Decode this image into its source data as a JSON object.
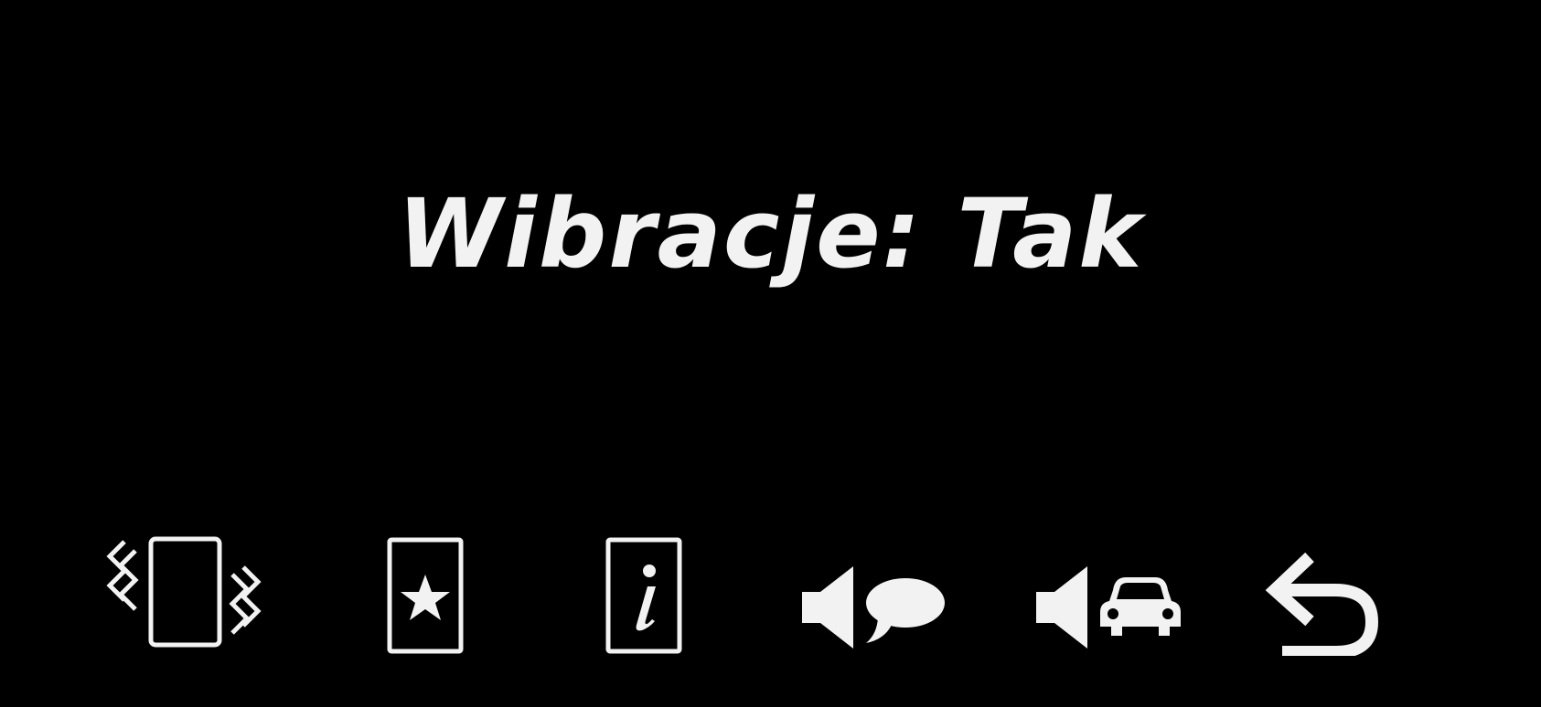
{
  "screen": {
    "status_text": "Wibracje: Tak"
  },
  "toolbar": {
    "items": [
      {
        "id": "vibration",
        "icon": "vibrating-phone-icon"
      },
      {
        "id": "favorites",
        "icon": "phone-star-icon"
      },
      {
        "id": "info",
        "icon": "phone-info-icon"
      },
      {
        "id": "voice-message-sound",
        "icon": "speaker-speech-bubble-icon"
      },
      {
        "id": "car-sound",
        "icon": "speaker-car-icon"
      },
      {
        "id": "back",
        "icon": "back-arrow-icon"
      }
    ]
  },
  "colors": {
    "background": "#000000",
    "foreground": "#f2f2f2"
  }
}
